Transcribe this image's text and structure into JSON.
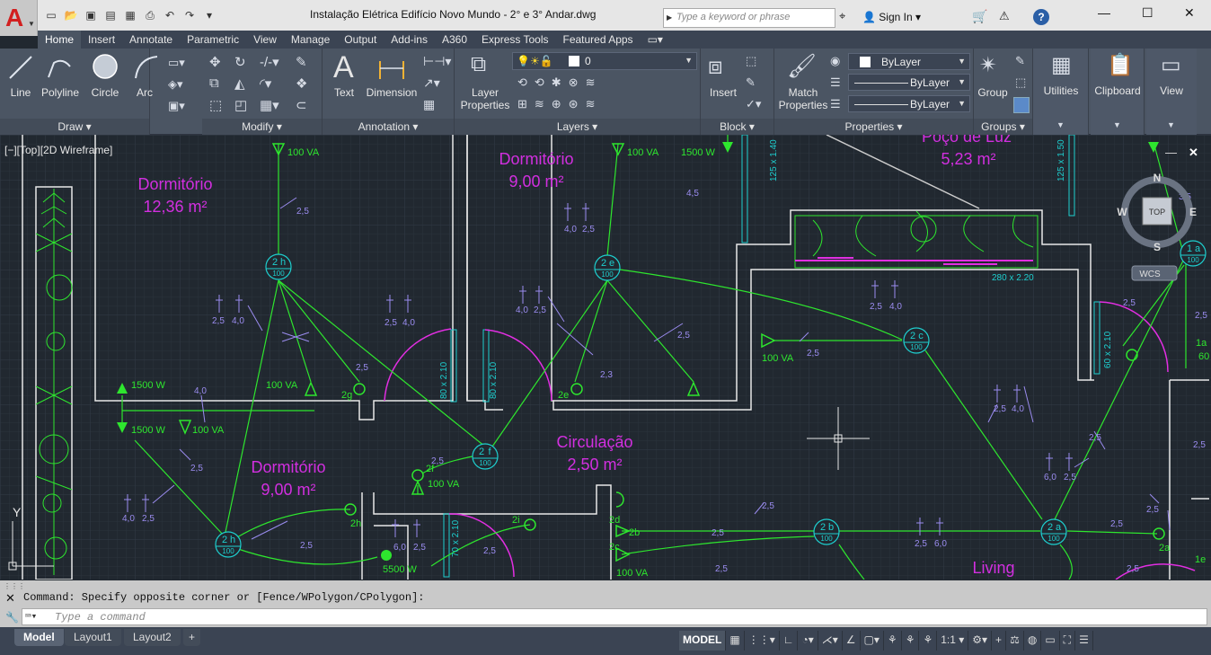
{
  "window": {
    "title": "Instalação Elétrica Edifício Novo Mundo - 2° e 3° Andar.dwg",
    "search_placeholder": "Type a keyword or phrase",
    "sign_in": "Sign In",
    "help": "?"
  },
  "app_button": {
    "letter": "A"
  },
  "tabs": [
    "Home",
    "Insert",
    "Annotate",
    "Parametric",
    "View",
    "Manage",
    "Output",
    "Add-ins",
    "A360",
    "Express Tools",
    "Featured Apps"
  ],
  "ribbon": {
    "draw": {
      "title": "Draw ▾",
      "line": "Line",
      "polyline": "Polyline",
      "circle": "Circle",
      "arc": "Arc"
    },
    "modify": {
      "title": "Modify ▾"
    },
    "annotation": {
      "title": "Annotation ▾",
      "text": "Text",
      "dimension": "Dimension"
    },
    "layers": {
      "title": "Layers ▾",
      "layer_properties_1": "Layer",
      "layer_properties_2": "Properties",
      "current_layer": "0"
    },
    "block": {
      "title": "Block ▾",
      "insert": "Insert"
    },
    "properties": {
      "title": "Properties ▾",
      "match_1": "Match",
      "match_2": "Properties",
      "color": "ByLayer",
      "linetype": "ByLayer",
      "lineweight": "ByLayer"
    },
    "groups": {
      "title": "Groups ▾",
      "group": "Group"
    },
    "utilities": {
      "label": "Utilities"
    },
    "clipboard": {
      "label": "Clipboard"
    },
    "view": {
      "label": "View"
    }
  },
  "viewport": {
    "label": "[−][Top][2D Wireframe]"
  },
  "viewcube": {
    "n": "N",
    "s": "S",
    "e": "E",
    "w": "W",
    "top": "TOP",
    "wcs": "WCS"
  },
  "drawing": {
    "rooms": [
      {
        "name": "Dormitório",
        "area": "12,36 m²"
      },
      {
        "name": "Dormitório",
        "area": "9,00 m²"
      },
      {
        "name": "Dormitório",
        "area": "9,00 m²"
      },
      {
        "name": "Circulação",
        "area": "2,50 m²"
      },
      {
        "name": "Poço de Luz",
        "area": "5,23 m²"
      },
      {
        "name": "Living",
        "area": ""
      }
    ],
    "circuits": [
      "2",
      "h",
      "100",
      "2",
      "e",
      "100",
      "2",
      "f",
      "100",
      "2",
      "g",
      "100",
      "2",
      "c",
      "100",
      "2",
      "b",
      "100",
      "2",
      "a",
      "100",
      "1",
      "a",
      "100"
    ],
    "loads": [
      "100 VA",
      "100 VA",
      "1500 W",
      "100 VA",
      "1500 W",
      "1500 W",
      "100 VA",
      "100 VA",
      "100 VA",
      "5500 W",
      "100 VA"
    ],
    "dims": [
      "80 x 2.10",
      "80 x 2.10",
      "70 x 2.10",
      "60 x 2.10",
      "280 x 2.20",
      "125 x 1.40",
      "125 x 1.50"
    ],
    "labels": [
      "2g",
      "2e",
      "2f",
      "2h",
      "2i",
      "2d",
      "2b",
      "2c",
      "2a",
      "1a",
      "1e",
      "60"
    ]
  },
  "ucs": {
    "y": "Y"
  },
  "command": {
    "history": "Command: Specify opposite corner or [Fence/WPolygon/CPolygon]:",
    "placeholder": "Type a command"
  },
  "layout_tabs": [
    "Model",
    "Layout1",
    "Layout2",
    "+"
  ],
  "status": {
    "model": "MODEL",
    "scale": "1:1"
  }
}
